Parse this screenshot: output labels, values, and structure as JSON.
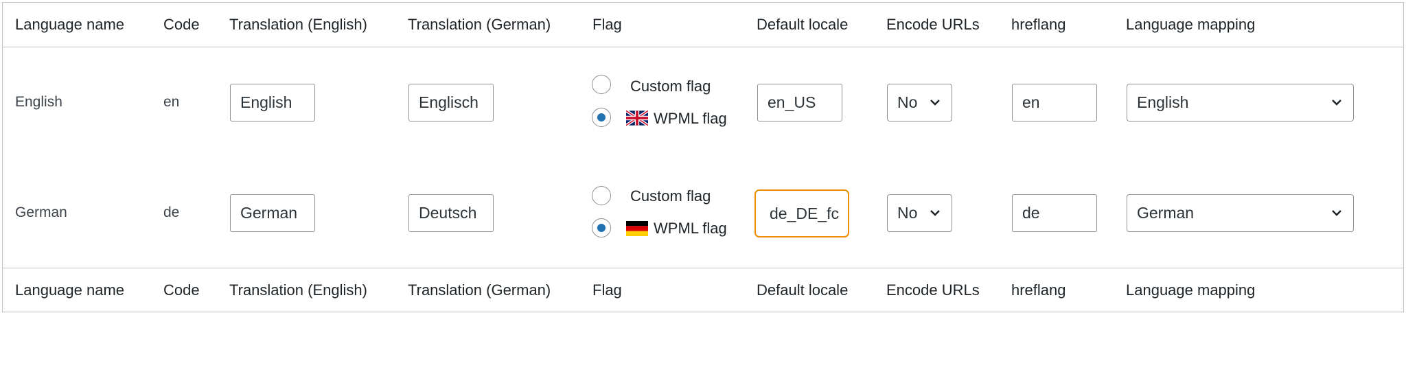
{
  "headers": [
    "Language name",
    "Code",
    "Translation (English)",
    "Translation (German)",
    "Flag",
    "Default locale",
    "Encode URLs",
    "hreflang",
    "Language mapping"
  ],
  "rows": [
    {
      "language_name": "English",
      "code": "en",
      "translation_english": "English",
      "translation_german": "Englisch",
      "flag_options": {
        "custom_label": "Custom flag",
        "wpml_label": "WPML flag",
        "selected": "wpml"
      },
      "flag_icon": "uk-flag-icon",
      "default_locale": "en_US",
      "encode_urls": "No",
      "hreflang": "en",
      "language_mapping": "English"
    },
    {
      "language_name": "German",
      "code": "de",
      "translation_english": "German",
      "translation_german": "Deutsch",
      "flag_options": {
        "custom_label": "Custom flag",
        "wpml_label": "WPML flag",
        "selected": "wpml"
      },
      "flag_icon": "germany-flag-icon",
      "default_locale": "de_DE_fc",
      "encode_urls": "No",
      "hreflang": "de",
      "language_mapping": "German"
    }
  ],
  "colors": {
    "focus_highlight": "#f08c00",
    "radio_selected": "#2271b1",
    "border": "#c3c4c7"
  }
}
